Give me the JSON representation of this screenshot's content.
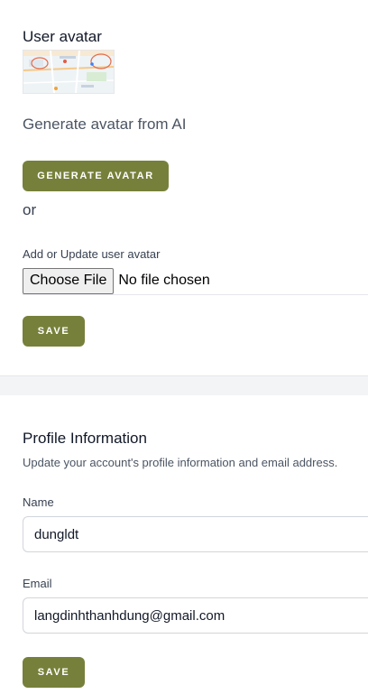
{
  "avatar_section": {
    "title": "User avatar",
    "generate_text": "Generate avatar from AI",
    "generate_button": "GENERATE AVATAR",
    "or_text": "or",
    "upload_label": "Add or Update user avatar",
    "choose_file_button": "Choose File",
    "file_status": "No file chosen",
    "save_button": "SAVE"
  },
  "profile_section": {
    "title": "Profile Information",
    "description": "Update your account's profile information and email address.",
    "name_label": "Name",
    "name_value": "dungldt",
    "email_label": "Email",
    "email_value": "langdinhthanhdung@gmail.com",
    "save_button": "SAVE"
  },
  "colors": {
    "accent": "#77803a",
    "background_band": "#f3f4f6"
  }
}
